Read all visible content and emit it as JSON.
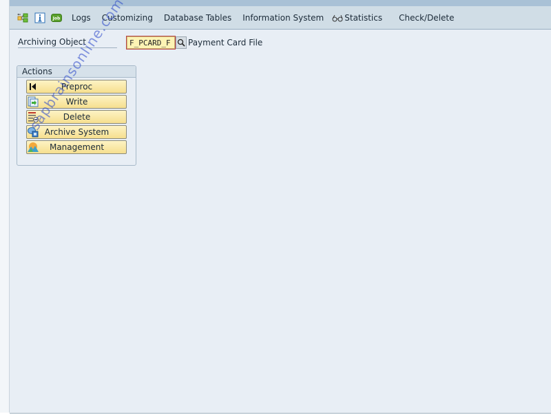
{
  "toolbar": {
    "icons": [
      "hierarchy-icon",
      "info-icon",
      "job-icon"
    ],
    "job_icon_text": "Job",
    "items": [
      {
        "label": "Logs"
      },
      {
        "label": "Customizing"
      },
      {
        "label": "Database Tables"
      },
      {
        "label": "Information System"
      },
      {
        "label": "Statistics",
        "icon": "glasses-icon"
      },
      {
        "label": "Check/Delete"
      }
    ]
  },
  "archiving_object": {
    "label": "Archiving Object",
    "value": "F_PCARD_F",
    "description": "Payment Card File"
  },
  "actions": {
    "title": "Actions",
    "buttons": [
      {
        "label": "Preproc",
        "icon": "first-page-icon"
      },
      {
        "label": "Write",
        "icon": "write-document-icon"
      },
      {
        "label": "Delete",
        "icon": "delete-list-icon"
      },
      {
        "label": "Archive System",
        "icon": "archive-system-icon"
      },
      {
        "label": "Management",
        "icon": "management-icon"
      }
    ]
  },
  "watermark": "sapbrainsonline.com",
  "colors": {
    "toolbar_bg": "#d0dde6",
    "content_bg": "#e8eef5",
    "button_bg": "#f6df8f",
    "input_bg": "#fdf3b4"
  }
}
